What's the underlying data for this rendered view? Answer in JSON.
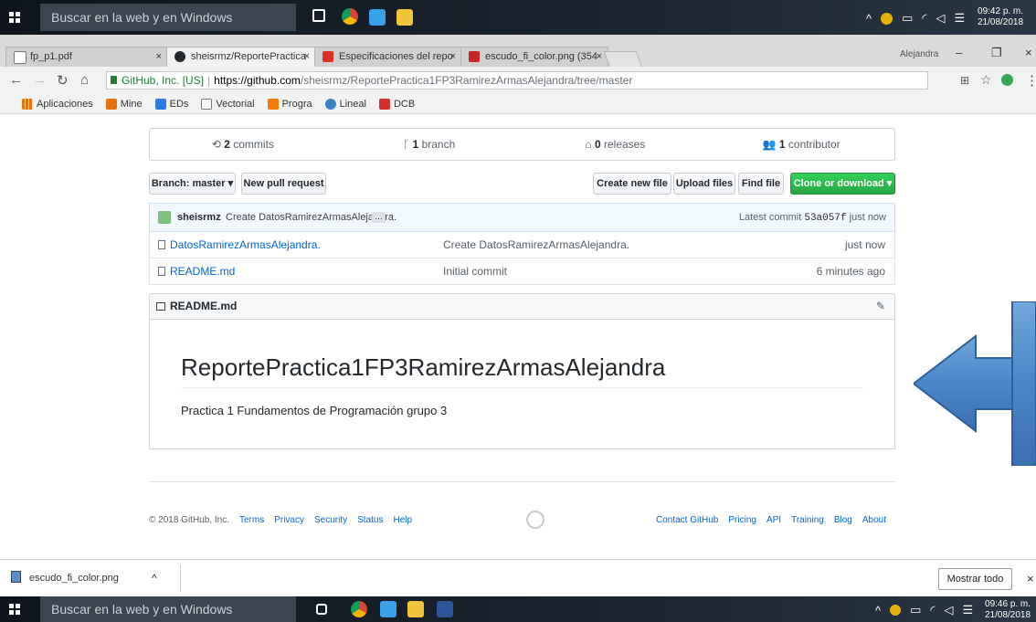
{
  "taskbar_top": {
    "search_placeholder": "Buscar en la web y en Windows",
    "clock_time": "09:42 p. m.",
    "clock_date": "21/08/2018"
  },
  "tabs": [
    {
      "label": "fp_p1.pdf",
      "close": "×"
    },
    {
      "label": "sheisrmz/ReportePractica",
      "close": "×"
    },
    {
      "label": "Especificaciones del repo",
      "close": "×"
    },
    {
      "label": "escudo_fi_color.png (354",
      "close": "×"
    }
  ],
  "window": {
    "user": "Alejandra",
    "minimize": "–",
    "maximize": "❐",
    "close": "×"
  },
  "addressbar": {
    "secure_label": "GitHub, Inc. [US]",
    "url_host": "https://github.com",
    "url_path": "/sheisrmz/ReportePractica1FP3RamirezArmasAlejandra/tree/master"
  },
  "bookmarks": [
    {
      "label": "Aplicaciones",
      "color": "#e8710a"
    },
    {
      "label": "Mine",
      "color": "#e8710a"
    },
    {
      "label": "EDs",
      "color": "#2c7be5"
    },
    {
      "label": "Vectorial",
      "color": "#ffffff"
    },
    {
      "label": "Progra",
      "color": "#f57c00"
    },
    {
      "label": "Lineal",
      "color": "#3b82c4"
    },
    {
      "label": "DCB",
      "color": "#d32f2f"
    }
  ],
  "repo": {
    "commits_count": "2",
    "commits_label": "commits",
    "branch_count": "1",
    "branch_label": "branch",
    "releases_count": "0",
    "releases_label": "releases",
    "contributors_count": "1",
    "contributors_label": "contributor",
    "branch_button": "Branch: master ▾",
    "new_pr": "New pull request",
    "create_file": "Create new file",
    "upload_files": "Upload files",
    "find_file": "Find file",
    "clone": "Clone or download ▾",
    "commit_author": "sheisrmz",
    "commit_message": "Create DatosRamirezArmasAlejandra.",
    "commit_more": "…",
    "latest_commit_label": "Latest commit",
    "commit_hash": "53a057f",
    "commit_time": "just now",
    "files": [
      {
        "name": "DatosRamirezArmasAlejandra.",
        "message": "Create DatosRamirezArmasAlejandra.",
        "time": "just now"
      },
      {
        "name": "README.md",
        "message": "Initial commit",
        "time": "6 minutes ago"
      }
    ],
    "readme_label": "README.md",
    "readme_title": "ReportePractica1FP3RamirezArmasAlejandra",
    "readme_text": "Practica 1 Fundamentos de Programación grupo 3"
  },
  "footer": {
    "copyright": "© 2018 GitHub, Inc.",
    "left_links": [
      "Terms",
      "Privacy",
      "Security",
      "Status",
      "Help"
    ],
    "right_links": [
      "Contact GitHub",
      "Pricing",
      "API",
      "Training",
      "Blog",
      "About"
    ]
  },
  "downloads": {
    "file": "escudo_fi_color.png",
    "chevron": "^",
    "show_all": "Mostrar todo",
    "close": "×"
  },
  "taskbar_bottom": {
    "search_placeholder": "Buscar en la web y en Windows",
    "clock_time": "09:46 p. m.",
    "clock_date": "21/08/2018"
  },
  "colors": {
    "accent_green": "#28a745",
    "link_blue": "#0366d6",
    "arrow_blue": "#4a86c8"
  }
}
